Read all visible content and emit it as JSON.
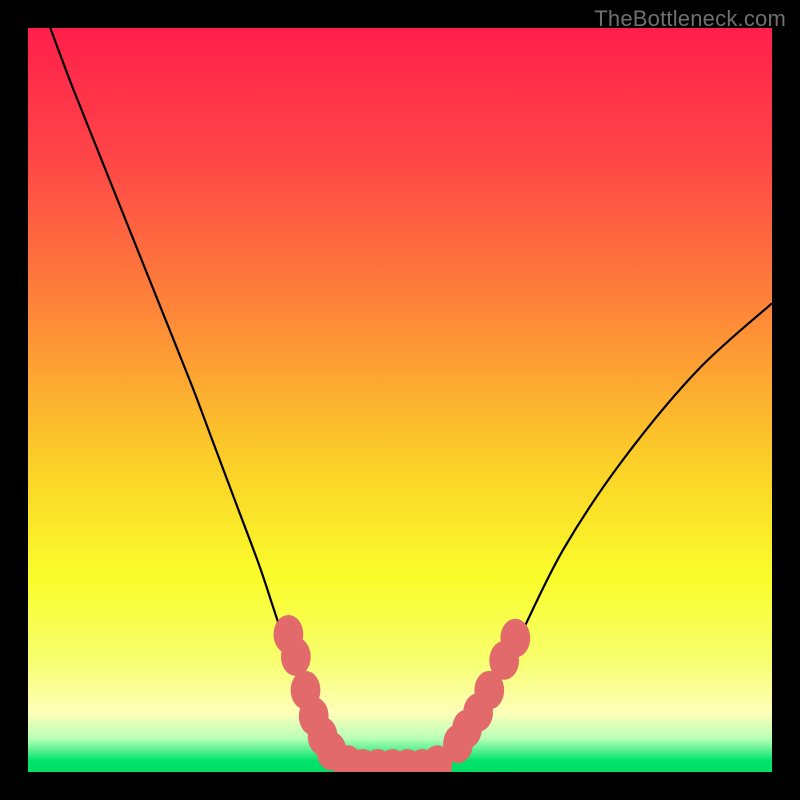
{
  "watermark": "TheBottleneck.com",
  "chart_data": {
    "type": "line",
    "title": "",
    "xlabel": "",
    "ylabel": "",
    "xlim": [
      0,
      100
    ],
    "ylim": [
      0,
      100
    ],
    "grid": false,
    "legend": false,
    "gradient_stops": [
      {
        "offset": 0.0,
        "color": "#ff1f4a"
      },
      {
        "offset": 0.18,
        "color": "#ff4747"
      },
      {
        "offset": 0.38,
        "color": "#fe8639"
      },
      {
        "offset": 0.58,
        "color": "#fbce28"
      },
      {
        "offset": 0.74,
        "color": "#fafd2a"
      },
      {
        "offset": 0.85,
        "color": "#f7ff6e"
      },
      {
        "offset": 0.92,
        "color": "#ffffb8"
      },
      {
        "offset": 0.955,
        "color": "#b8ffb8"
      },
      {
        "offset": 0.985,
        "color": "#00e36b"
      },
      {
        "offset": 1.0,
        "color": "#00de66"
      }
    ],
    "series": [
      {
        "name": "bottleneck-curve",
        "color": "#000000",
        "x": [
          3,
          6,
          10,
          14,
          18,
          22,
          25,
          28,
          31,
          33,
          35,
          37,
          38.5,
          40,
          41.5,
          43,
          45,
          48,
          52,
          55,
          57,
          59,
          62,
          66,
          72,
          80,
          90,
          100
        ],
        "y": [
          100,
          92,
          82,
          72,
          62,
          52,
          44,
          36,
          28,
          22,
          16,
          11,
          7,
          4,
          2,
          1,
          0.5,
          0.5,
          0.5,
          1,
          2.5,
          5,
          10,
          18,
          30,
          42,
          54,
          63
        ]
      }
    ],
    "markers": {
      "name": "highlighted-points",
      "color": "#e26a6a",
      "radius_x": 2.0,
      "radius_y": 2.6,
      "points": [
        {
          "x": 35.0,
          "y": 18.5
        },
        {
          "x": 36.0,
          "y": 15.5
        },
        {
          "x": 37.3,
          "y": 11.0
        },
        {
          "x": 38.4,
          "y": 7.5
        },
        {
          "x": 39.6,
          "y": 4.8
        },
        {
          "x": 40.8,
          "y": 2.8
        },
        {
          "x": 43.0,
          "y": 1.0
        },
        {
          "x": 45.0,
          "y": 0.5
        },
        {
          "x": 47.0,
          "y": 0.5
        },
        {
          "x": 49.0,
          "y": 0.5
        },
        {
          "x": 51.0,
          "y": 0.5
        },
        {
          "x": 53.0,
          "y": 0.5
        },
        {
          "x": 55.0,
          "y": 1.0
        },
        {
          "x": 57.8,
          "y": 3.8
        },
        {
          "x": 59.0,
          "y": 5.8
        },
        {
          "x": 60.5,
          "y": 8.0
        },
        {
          "x": 62.0,
          "y": 11.0
        },
        {
          "x": 64.0,
          "y": 15.0
        },
        {
          "x": 65.5,
          "y": 18.0
        }
      ]
    }
  }
}
